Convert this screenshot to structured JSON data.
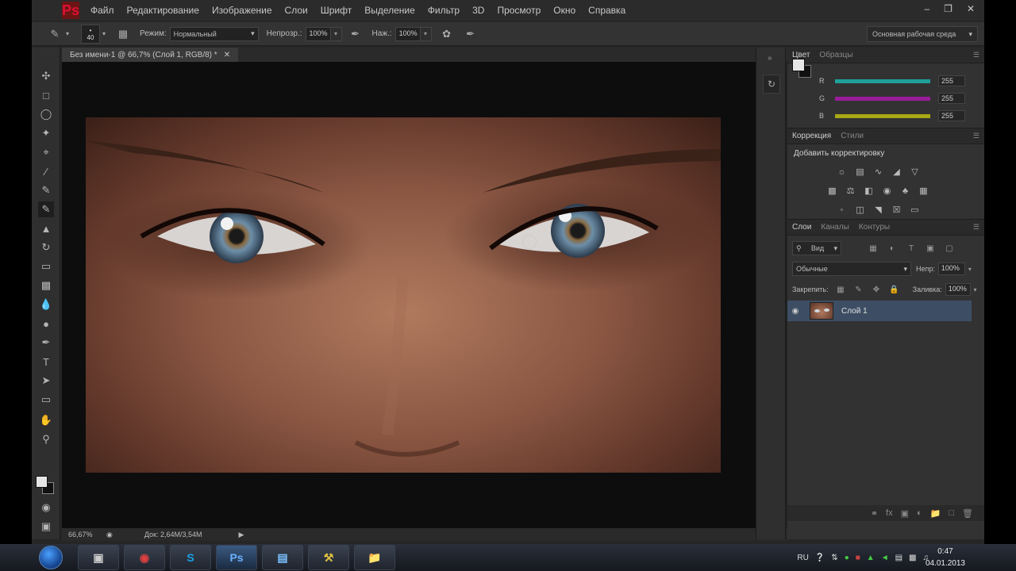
{
  "menubar": {
    "logo": "Ps",
    "items": [
      "Файл",
      "Редактирование",
      "Изображение",
      "Слои",
      "Шрифт",
      "Выделение",
      "Фильтр",
      "3D",
      "Просмотр",
      "Окно",
      "Справка"
    ]
  },
  "options": {
    "brush_size": "40",
    "mode_label": "Режим:",
    "mode_value": "Нормальный",
    "opacity_label": "Непрозр.:",
    "opacity_value": "100%",
    "pressure_label": "Наж.:",
    "pressure_value": "100%",
    "workspace": "Основная рабочая среда"
  },
  "document": {
    "tab_title": "Без имени-1 @ 66,7% (Слой 1, RGB/8) *",
    "zoom": "66,67%",
    "doc_info": "Док: 2,64M/3,54M"
  },
  "color_panel": {
    "tabs": [
      "Цвет",
      "Образцы"
    ],
    "channels": [
      {
        "label": "R",
        "value": "255",
        "color": "#1fa09a"
      },
      {
        "label": "G",
        "value": "255",
        "color": "#9a1c9a"
      },
      {
        "label": "B",
        "value": "255",
        "color": "#a8a814"
      }
    ]
  },
  "adjustments": {
    "tabs": [
      "Коррекция",
      "Стили"
    ],
    "title": "Добавить корректировку"
  },
  "layers": {
    "tabs": [
      "Слои",
      "Каналы",
      "Контуры"
    ],
    "filter_label": "Вид",
    "blend_mode": "Обычные",
    "opacity_label": "Непр:",
    "opacity_value": "100%",
    "lock_label": "Закрепить:",
    "fill_label": "Заливка:",
    "fill_value": "100%",
    "layer_name": "Слой 1"
  },
  "taskbar": {
    "lang": "RU",
    "time": "0:47",
    "date": "04.01.2013"
  }
}
